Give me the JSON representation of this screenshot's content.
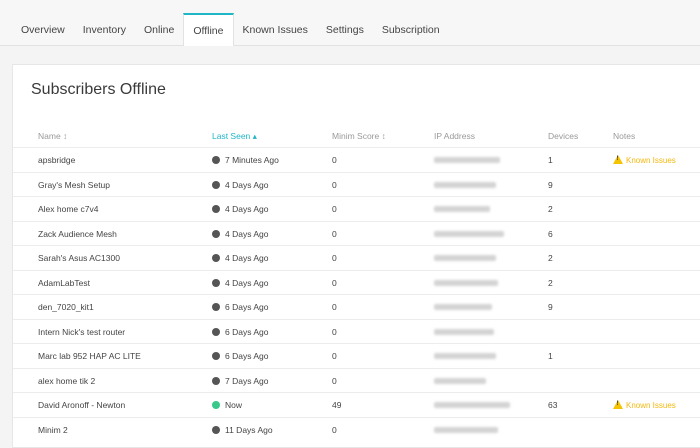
{
  "tabs": [
    {
      "label": "Overview",
      "active": false
    },
    {
      "label": "Inventory",
      "active": false
    },
    {
      "label": "Online",
      "active": false
    },
    {
      "label": "Offline",
      "active": true
    },
    {
      "label": "Known Issues",
      "active": false
    },
    {
      "label": "Settings",
      "active": false
    },
    {
      "label": "Subscription",
      "active": false
    }
  ],
  "panel": {
    "title": "Subscribers Offline"
  },
  "table": {
    "headers": {
      "name": "Name ↕",
      "last_seen": "Last Seen ▴",
      "score": "Minim Score ↕",
      "ip": "IP Address",
      "devices": "Devices",
      "notes": "Notes"
    },
    "rows": [
      {
        "name": "apsbridge",
        "last_seen": "7 Minutes Ago",
        "status": "offline",
        "score": "0",
        "devices": "1",
        "notes": "Known Issues"
      },
      {
        "name": "Gray's Mesh Setup",
        "last_seen": "4 Days Ago",
        "status": "offline",
        "score": "0",
        "devices": "9",
        "notes": ""
      },
      {
        "name": "Alex home c7v4",
        "last_seen": "4 Days Ago",
        "status": "offline",
        "score": "0",
        "devices": "2",
        "notes": ""
      },
      {
        "name": "Zack Audience Mesh",
        "last_seen": "4 Days Ago",
        "status": "offline",
        "score": "0",
        "devices": "6",
        "notes": ""
      },
      {
        "name": "Sarah's Asus AC1300",
        "last_seen": "4 Days Ago",
        "status": "offline",
        "score": "0",
        "devices": "2",
        "notes": ""
      },
      {
        "name": "AdamLabTest",
        "last_seen": "4 Days Ago",
        "status": "offline",
        "score": "0",
        "devices": "2",
        "notes": ""
      },
      {
        "name": "den_7020_kit1",
        "last_seen": "6 Days Ago",
        "status": "offline",
        "score": "0",
        "devices": "9",
        "notes": ""
      },
      {
        "name": "Intern Nick's test router",
        "last_seen": "6 Days Ago",
        "status": "offline",
        "score": "0",
        "devices": "",
        "notes": ""
      },
      {
        "name": "Marc lab 952 HAP AC LITE",
        "last_seen": "6 Days Ago",
        "status": "offline",
        "score": "0",
        "devices": "1",
        "notes": ""
      },
      {
        "name": "alex home tik 2",
        "last_seen": "7 Days Ago",
        "status": "offline",
        "score": "0",
        "devices": "",
        "notes": ""
      },
      {
        "name": "David Aronoff - Newton",
        "last_seen": "Now",
        "status": "online",
        "score": "49",
        "devices": "63",
        "notes": "Known Issues"
      },
      {
        "name": "Minim 2",
        "last_seen": "11 Days Ago",
        "status": "offline",
        "score": "0",
        "devices": "",
        "notes": ""
      }
    ]
  }
}
